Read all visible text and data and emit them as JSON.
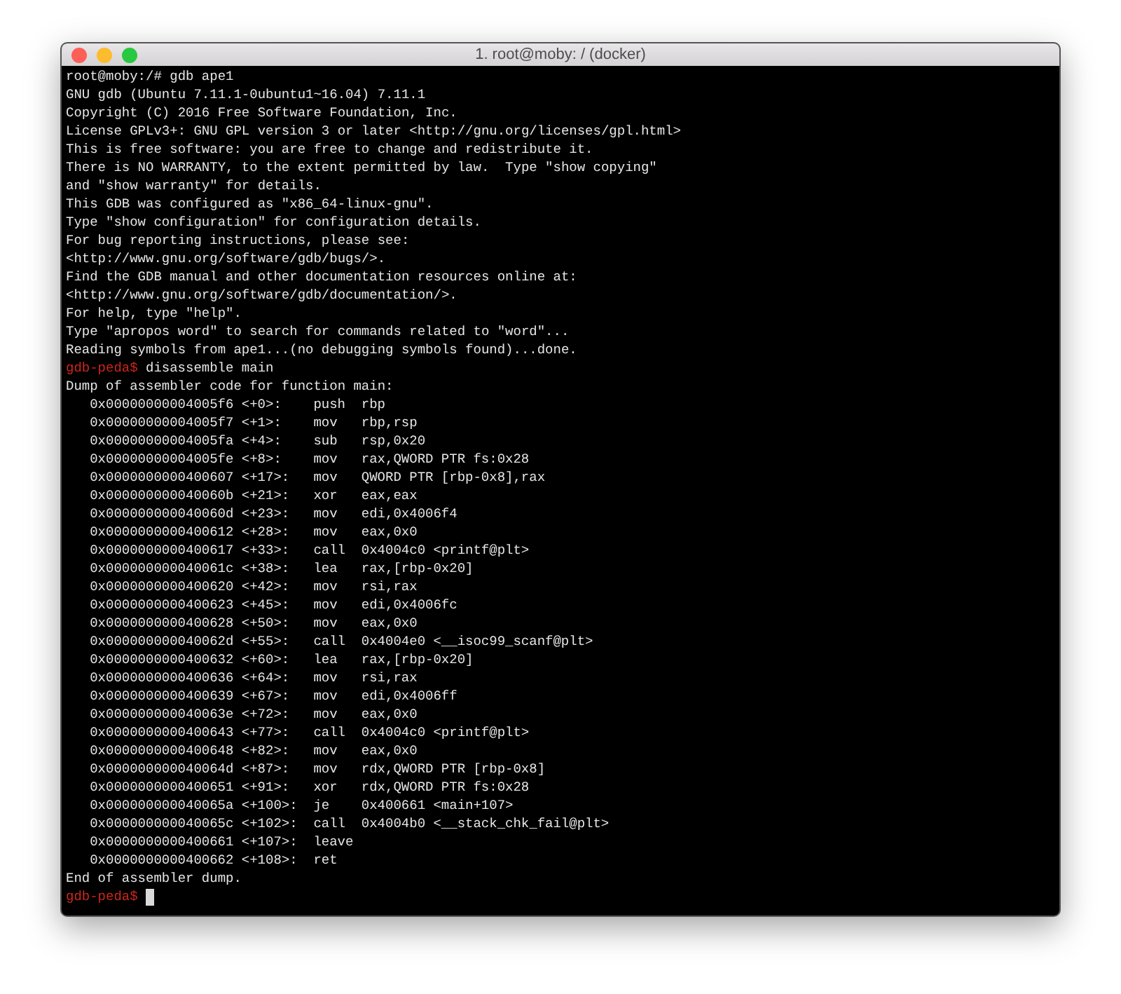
{
  "window": {
    "title": "1. root@moby: / (docker)"
  },
  "lines": [
    {
      "kind": "text",
      "text": "root@moby:/# gdb ape1"
    },
    {
      "kind": "text",
      "text": "GNU gdb (Ubuntu 7.11.1-0ubuntu1~16.04) 7.11.1"
    },
    {
      "kind": "text",
      "text": "Copyright (C) 2016 Free Software Foundation, Inc."
    },
    {
      "kind": "text",
      "text": "License GPLv3+: GNU GPL version 3 or later <http://gnu.org/licenses/gpl.html>"
    },
    {
      "kind": "text",
      "text": "This is free software: you are free to change and redistribute it."
    },
    {
      "kind": "text",
      "text": "There is NO WARRANTY, to the extent permitted by law.  Type \"show copying\""
    },
    {
      "kind": "text",
      "text": "and \"show warranty\" for details."
    },
    {
      "kind": "text",
      "text": "This GDB was configured as \"x86_64-linux-gnu\"."
    },
    {
      "kind": "text",
      "text": "Type \"show configuration\" for configuration details."
    },
    {
      "kind": "text",
      "text": "For bug reporting instructions, please see:"
    },
    {
      "kind": "text",
      "text": "<http://www.gnu.org/software/gdb/bugs/>."
    },
    {
      "kind": "text",
      "text": "Find the GDB manual and other documentation resources online at:"
    },
    {
      "kind": "text",
      "text": "<http://www.gnu.org/software/gdb/documentation/>."
    },
    {
      "kind": "text",
      "text": "For help, type \"help\"."
    },
    {
      "kind": "text",
      "text": "Type \"apropos word\" to search for commands related to \"word\"..."
    },
    {
      "kind": "text",
      "text": "Reading symbols from ape1...(no debugging symbols found)...done."
    },
    {
      "kind": "prompt",
      "prompt": "gdb-peda$",
      "command": "disassemble main"
    },
    {
      "kind": "text",
      "text": "Dump of assembler code for function main:"
    },
    {
      "kind": "asm",
      "address": "0x00000000004005f6",
      "offset": "<+0>:",
      "mnemonic": "push",
      "operands": "rbp"
    },
    {
      "kind": "asm",
      "address": "0x00000000004005f7",
      "offset": "<+1>:",
      "mnemonic": "mov",
      "operands": "rbp,rsp"
    },
    {
      "kind": "asm",
      "address": "0x00000000004005fa",
      "offset": "<+4>:",
      "mnemonic": "sub",
      "operands": "rsp,0x20"
    },
    {
      "kind": "asm",
      "address": "0x00000000004005fe",
      "offset": "<+8>:",
      "mnemonic": "mov",
      "operands": "rax,QWORD PTR fs:0x28"
    },
    {
      "kind": "asm",
      "address": "0x0000000000400607",
      "offset": "<+17>:",
      "mnemonic": "mov",
      "operands": "QWORD PTR [rbp-0x8],rax"
    },
    {
      "kind": "asm",
      "address": "0x000000000040060b",
      "offset": "<+21>:",
      "mnemonic": "xor",
      "operands": "eax,eax"
    },
    {
      "kind": "asm",
      "address": "0x000000000040060d",
      "offset": "<+23>:",
      "mnemonic": "mov",
      "operands": "edi,0x4006f4"
    },
    {
      "kind": "asm",
      "address": "0x0000000000400612",
      "offset": "<+28>:",
      "mnemonic": "mov",
      "operands": "eax,0x0"
    },
    {
      "kind": "asm",
      "address": "0x0000000000400617",
      "offset": "<+33>:",
      "mnemonic": "call",
      "operands": "0x4004c0 <printf@plt>"
    },
    {
      "kind": "asm",
      "address": "0x000000000040061c",
      "offset": "<+38>:",
      "mnemonic": "lea",
      "operands": "rax,[rbp-0x20]"
    },
    {
      "kind": "asm",
      "address": "0x0000000000400620",
      "offset": "<+42>:",
      "mnemonic": "mov",
      "operands": "rsi,rax"
    },
    {
      "kind": "asm",
      "address": "0x0000000000400623",
      "offset": "<+45>:",
      "mnemonic": "mov",
      "operands": "edi,0x4006fc"
    },
    {
      "kind": "asm",
      "address": "0x0000000000400628",
      "offset": "<+50>:",
      "mnemonic": "mov",
      "operands": "eax,0x0"
    },
    {
      "kind": "asm",
      "address": "0x000000000040062d",
      "offset": "<+55>:",
      "mnemonic": "call",
      "operands": "0x4004e0 <__isoc99_scanf@plt>"
    },
    {
      "kind": "asm",
      "address": "0x0000000000400632",
      "offset": "<+60>:",
      "mnemonic": "lea",
      "operands": "rax,[rbp-0x20]"
    },
    {
      "kind": "asm",
      "address": "0x0000000000400636",
      "offset": "<+64>:",
      "mnemonic": "mov",
      "operands": "rsi,rax"
    },
    {
      "kind": "asm",
      "address": "0x0000000000400639",
      "offset": "<+67>:",
      "mnemonic": "mov",
      "operands": "edi,0x4006ff"
    },
    {
      "kind": "asm",
      "address": "0x000000000040063e",
      "offset": "<+72>:",
      "mnemonic": "mov",
      "operands": "eax,0x0"
    },
    {
      "kind": "asm",
      "address": "0x0000000000400643",
      "offset": "<+77>:",
      "mnemonic": "call",
      "operands": "0x4004c0 <printf@plt>"
    },
    {
      "kind": "asm",
      "address": "0x0000000000400648",
      "offset": "<+82>:",
      "mnemonic": "mov",
      "operands": "eax,0x0"
    },
    {
      "kind": "asm",
      "address": "0x000000000040064d",
      "offset": "<+87>:",
      "mnemonic": "mov",
      "operands": "rdx,QWORD PTR [rbp-0x8]"
    },
    {
      "kind": "asm",
      "address": "0x0000000000400651",
      "offset": "<+91>:",
      "mnemonic": "xor",
      "operands": "rdx,QWORD PTR fs:0x28"
    },
    {
      "kind": "asm",
      "address": "0x000000000040065a",
      "offset": "<+100>:",
      "mnemonic": "je",
      "operands": "0x400661 <main+107>"
    },
    {
      "kind": "asm",
      "address": "0x000000000040065c",
      "offset": "<+102>:",
      "mnemonic": "call",
      "operands": "0x4004b0 <__stack_chk_fail@plt>"
    },
    {
      "kind": "asm",
      "address": "0x0000000000400661",
      "offset": "<+107>:",
      "mnemonic": "leave"
    },
    {
      "kind": "asm",
      "address": "0x0000000000400662",
      "offset": "<+108>:",
      "mnemonic": "ret"
    },
    {
      "kind": "text",
      "text": "End of assembler dump."
    },
    {
      "kind": "prompt",
      "prompt": "gdb-peda$",
      "cursor": true
    }
  ]
}
